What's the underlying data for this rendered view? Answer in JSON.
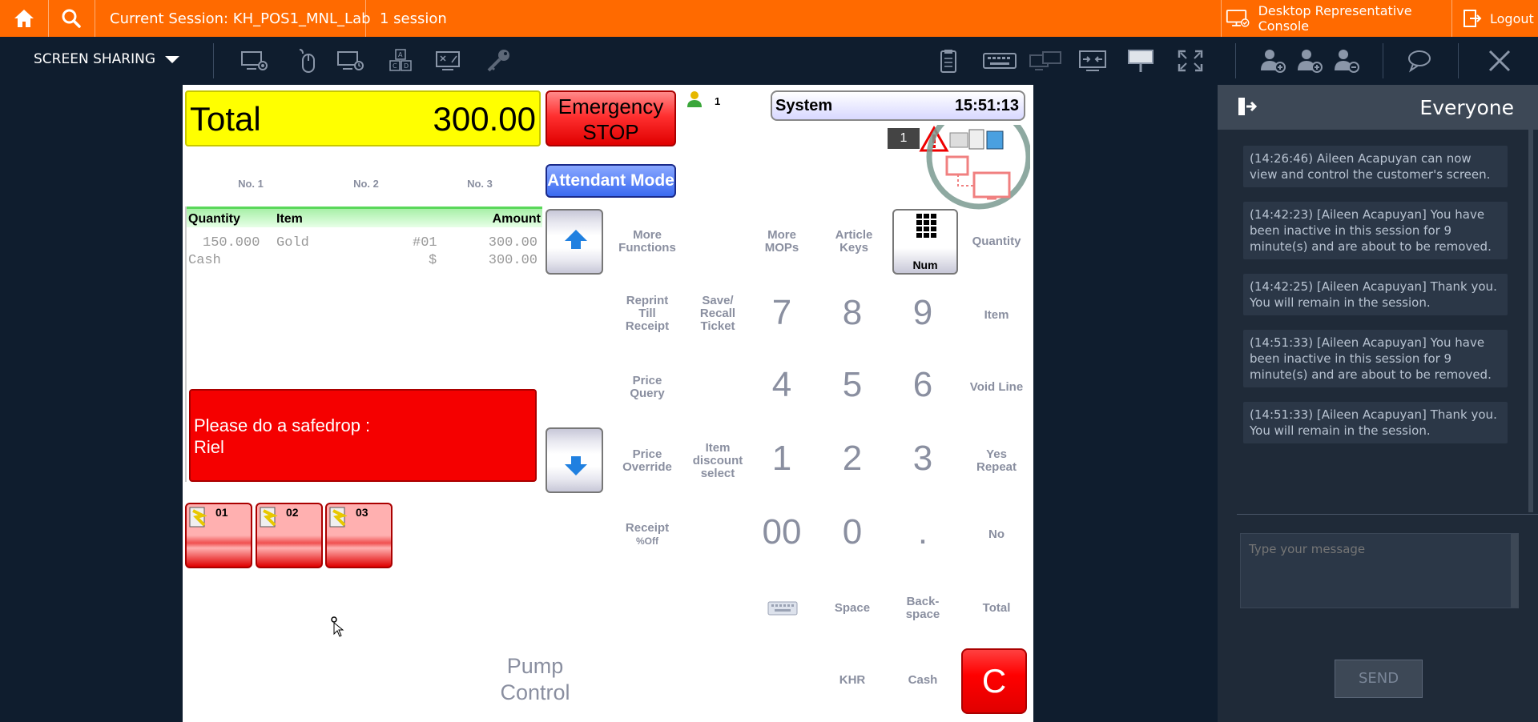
{
  "topbar": {
    "session_label": "Current Session: KH_POS1_MNL_Lab",
    "session_count": "1 session",
    "desktop_console": "Desktop Representative Console",
    "logout": "Logout"
  },
  "toolbar": {
    "screen_sharing": "SCREEN SHARING"
  },
  "pos": {
    "total_label": "Total",
    "total_value": "300.00",
    "emergency_line1": "Emergency",
    "emergency_line2": "STOP",
    "attendant_count": "1",
    "attendant_mode": "Attendant Mode",
    "system_label": "System",
    "time": "15:51:13",
    "status_count": "1",
    "tabs": [
      "No. 1",
      "No. 2",
      "No. 3"
    ],
    "receipt_headers": {
      "quantity": "Quantity",
      "item": "Item",
      "amount": "Amount"
    },
    "receipt_lines": [
      {
        "qty": "150.000",
        "item": "Gold",
        "ref": "#01",
        "amount": "300.00"
      },
      {
        "qty": "Cash",
        "item": "",
        "ref": "$",
        "amount": "300.00"
      }
    ],
    "safedrop_line1": "Please do a safedrop :",
    "safedrop_line2": "Riel",
    "pumps": [
      "01",
      "02",
      "03"
    ],
    "pump_control_line1": "Pump",
    "pump_control_line2": "Control",
    "functions": {
      "more_functions": [
        "More",
        "Functions"
      ],
      "more_mops": [
        "More",
        "MOPs"
      ],
      "article_keys": [
        "Article",
        "Keys"
      ],
      "num": "Num",
      "quantity": "Quantity",
      "reprint": [
        "Reprint",
        "Till",
        "Receipt"
      ],
      "save_recall": [
        "Save/",
        "Recall",
        "Ticket"
      ],
      "item": "Item",
      "price_query": [
        "Price",
        "Query"
      ],
      "void_line": "Void Line",
      "price_override": [
        "Price",
        "Override"
      ],
      "item_discount": [
        "Item",
        "discount",
        "select"
      ],
      "yes_repeat": [
        "Yes",
        "Repeat"
      ],
      "receipt_off": [
        "Receipt",
        "%Off"
      ],
      "no": "No",
      "space": "Space",
      "backspace": [
        "Back-",
        "space"
      ],
      "total": "Total",
      "khr": "KHR",
      "cash": "Cash",
      "clear": "C"
    },
    "numpad": [
      "7",
      "8",
      "9",
      "4",
      "5",
      "6",
      "1",
      "2",
      "3",
      "00",
      "0",
      "."
    ]
  },
  "chat": {
    "title": "Everyone",
    "messages": [
      "(14:26:46) Aileen Acapuyan can now view and control the customer's screen.",
      "(14:42:23) [Aileen Acapuyan] You have been inactive in this session for 9 minute(s) and are about to be removed.",
      "(14:42:25) [Aileen Acapuyan] Thank you.  You will remain in the session.",
      "(14:51:33) [Aileen Acapuyan] You have been inactive in this session for 9 minute(s) and are about to be removed.",
      "(14:51:33) [Aileen Acapuyan] Thank you.  You will remain in the session."
    ],
    "placeholder": "Type your message",
    "send": "SEND"
  }
}
